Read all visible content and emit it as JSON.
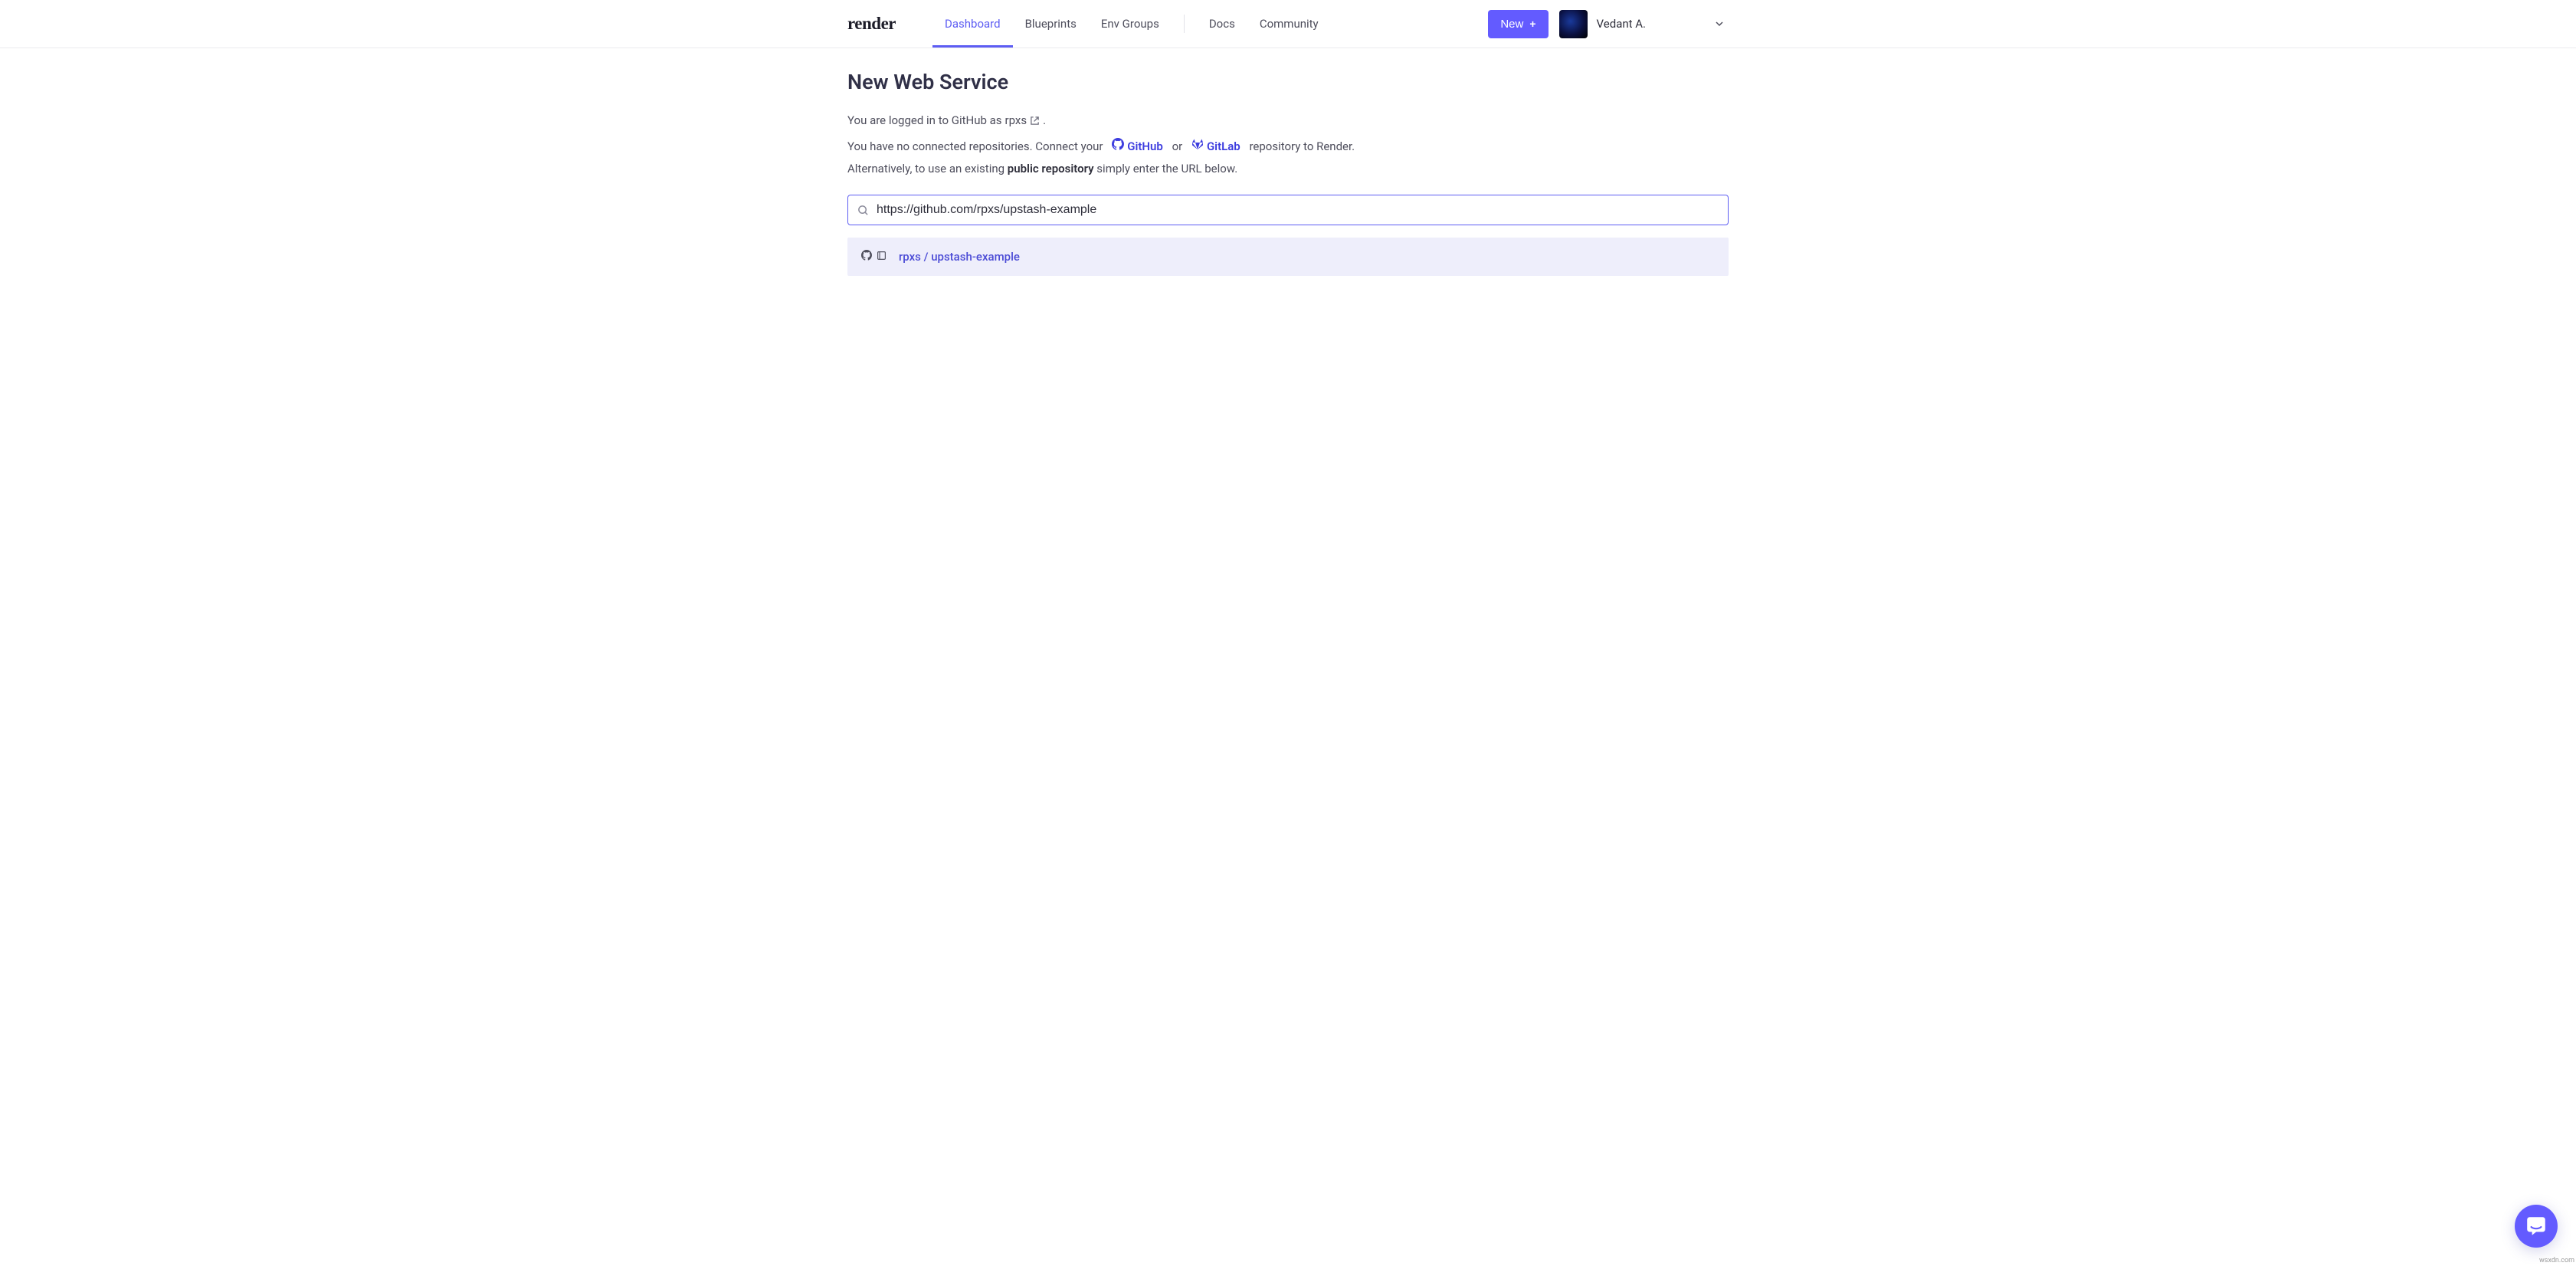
{
  "header": {
    "logo": "render",
    "nav": {
      "dashboard": "Dashboard",
      "blueprints": "Blueprints",
      "env_groups": "Env Groups",
      "docs": "Docs",
      "community": "Community"
    },
    "new_button": "New",
    "user_name": "Vedant A."
  },
  "page": {
    "title": "New Web Service",
    "logged_in_prefix": "You are logged in to GitHub as ",
    "logged_in_user": "rpxs",
    "logged_in_suffix": ".",
    "connect_line_1": "You have no connected repositories. Connect your",
    "github_label": "GitHub",
    "or_text": "or",
    "gitlab_label": "GitLab",
    "connect_line_2": "repository to Render.",
    "alt_line_1": "Alternatively, to use an existing ",
    "public_repo_bold": "public repository",
    "alt_line_2": " simply enter the URL below."
  },
  "search": {
    "value": "https://github.com/rpxs/upstash-example",
    "placeholder": ""
  },
  "result": {
    "label": "rpxs / upstash-example"
  },
  "watermark": "wsxdn.com"
}
